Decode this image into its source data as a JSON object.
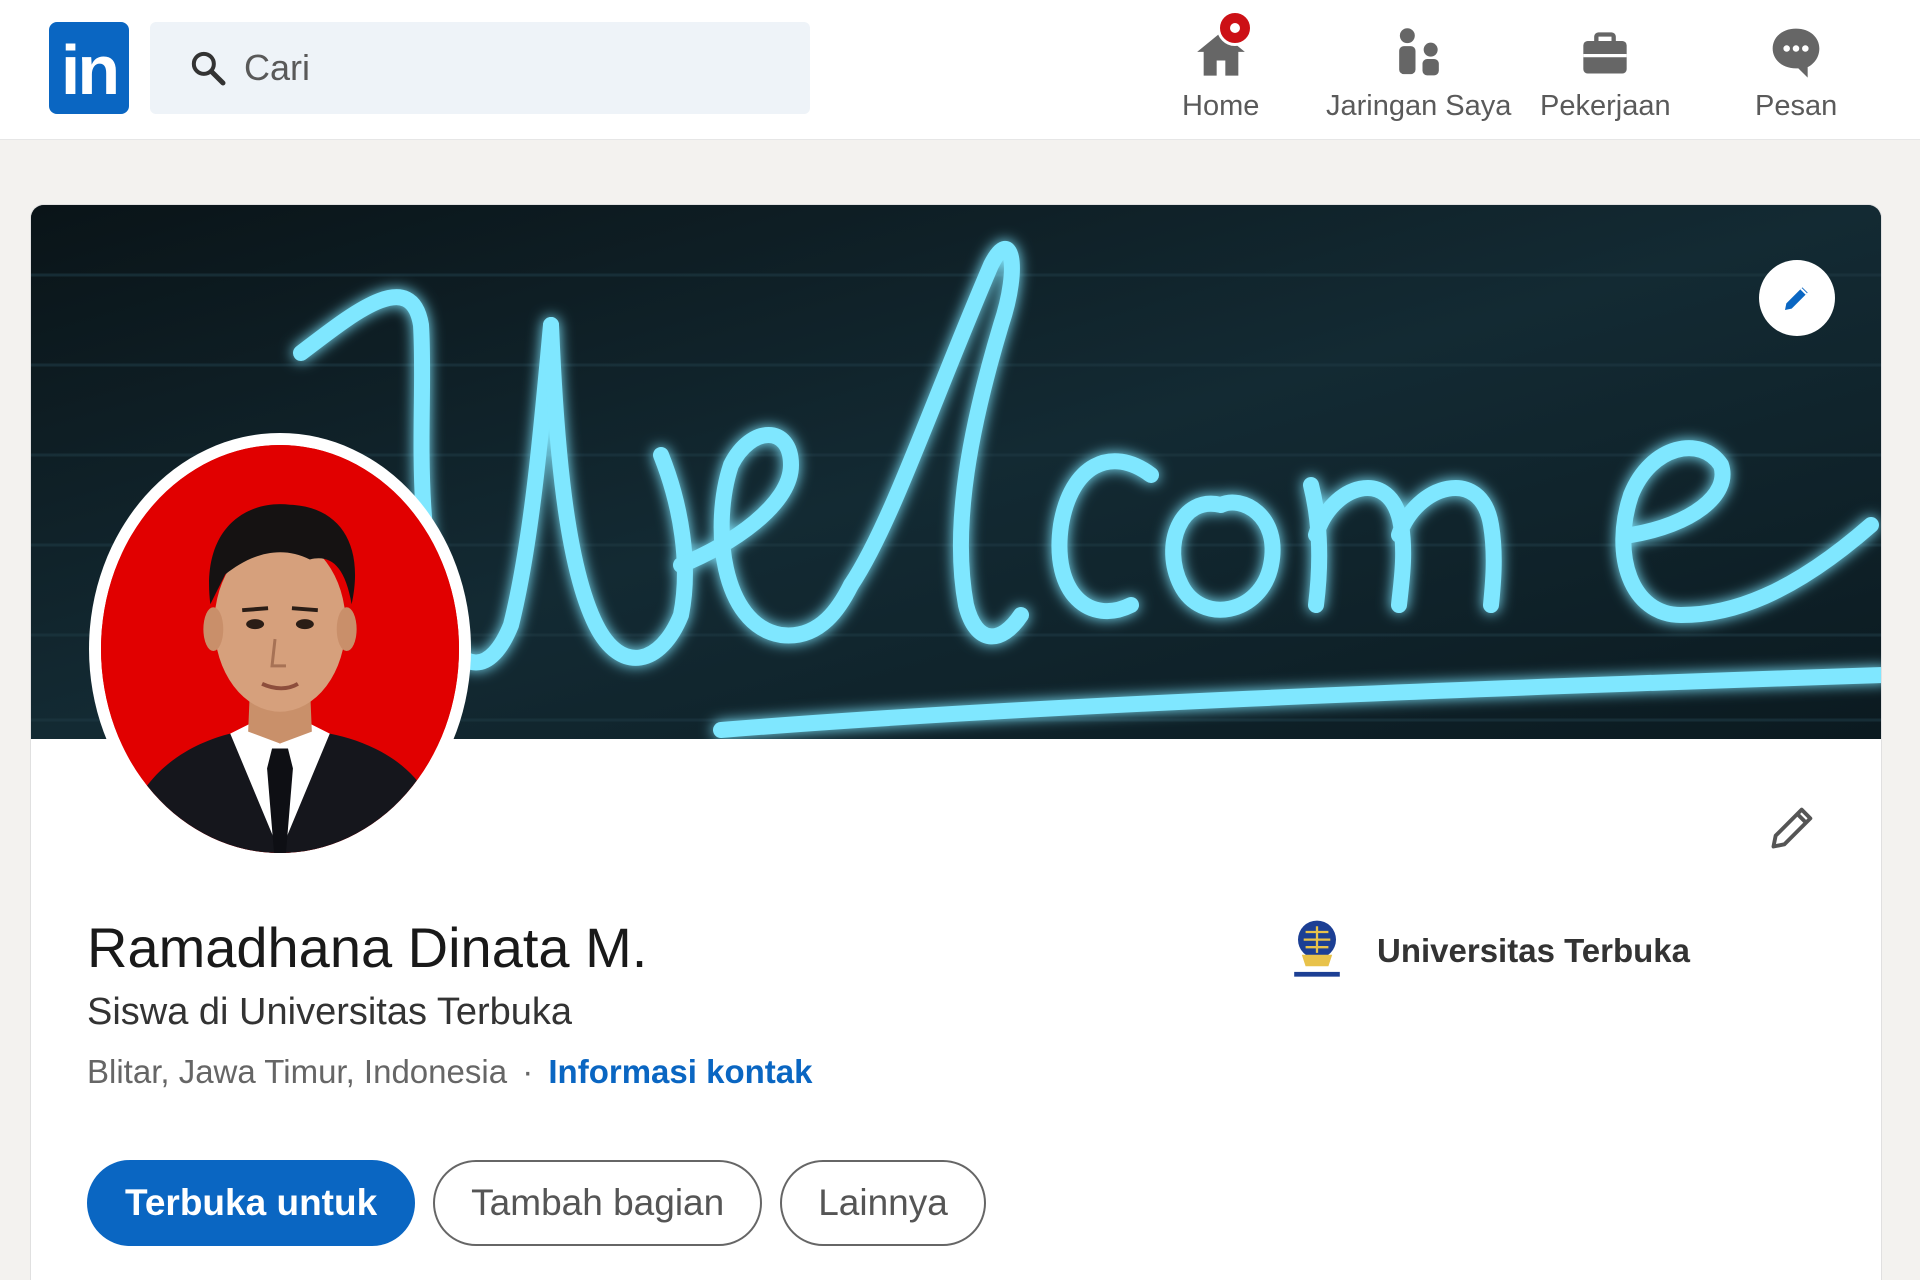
{
  "nav": {
    "logo_text": "in",
    "search_placeholder": "Cari",
    "items": [
      {
        "label": "Home",
        "icon": "home-icon"
      },
      {
        "label": "Jaringan Saya",
        "icon": "people-icon"
      },
      {
        "label": "Pekerjaan",
        "icon": "briefcase-icon"
      },
      {
        "label": "Pesan",
        "icon": "message-icon"
      }
    ]
  },
  "banner": {
    "text": "Welcome",
    "neon_color": "#7fe7ff"
  },
  "profile": {
    "name": "Ramadhana Dinata M.",
    "headline": "Siswa di Universitas Terbuka",
    "location": "Blitar, Jawa Timur, Indonesia",
    "separator": "·",
    "contact_link": "Informasi kontak",
    "education": "Universitas Terbuka"
  },
  "actions": {
    "primary": "Terbuka untuk",
    "add_section": "Tambah bagian",
    "more": "Lainnya"
  },
  "colors": {
    "brand": "#0a66c2",
    "badge": "#cc1016",
    "avatar_bg": "#e10000"
  }
}
